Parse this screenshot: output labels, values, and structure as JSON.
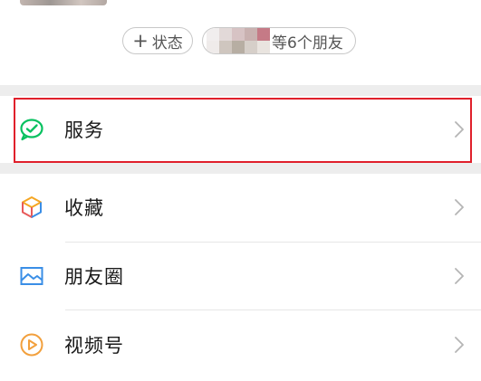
{
  "status": {
    "add_label": "状态",
    "plus_symbol": "+",
    "friends_label": "等6个朋友"
  },
  "menu": [
    {
      "label": "服务",
      "icon": "wechat-pay-icon",
      "icon_color": "#07c160"
    },
    {
      "label": "收藏",
      "icon": "cube-icon",
      "icon_color": "#f5a623"
    },
    {
      "label": "朋友圈",
      "icon": "photo-icon",
      "icon_color": "#3a8ee6"
    },
    {
      "label": "视频号",
      "icon": "play-icon",
      "icon_color": "#f2a03d"
    }
  ],
  "colors": {
    "highlight": "#e0202b",
    "chevron": "#b5b5b5",
    "section_gap": "#ededed"
  }
}
